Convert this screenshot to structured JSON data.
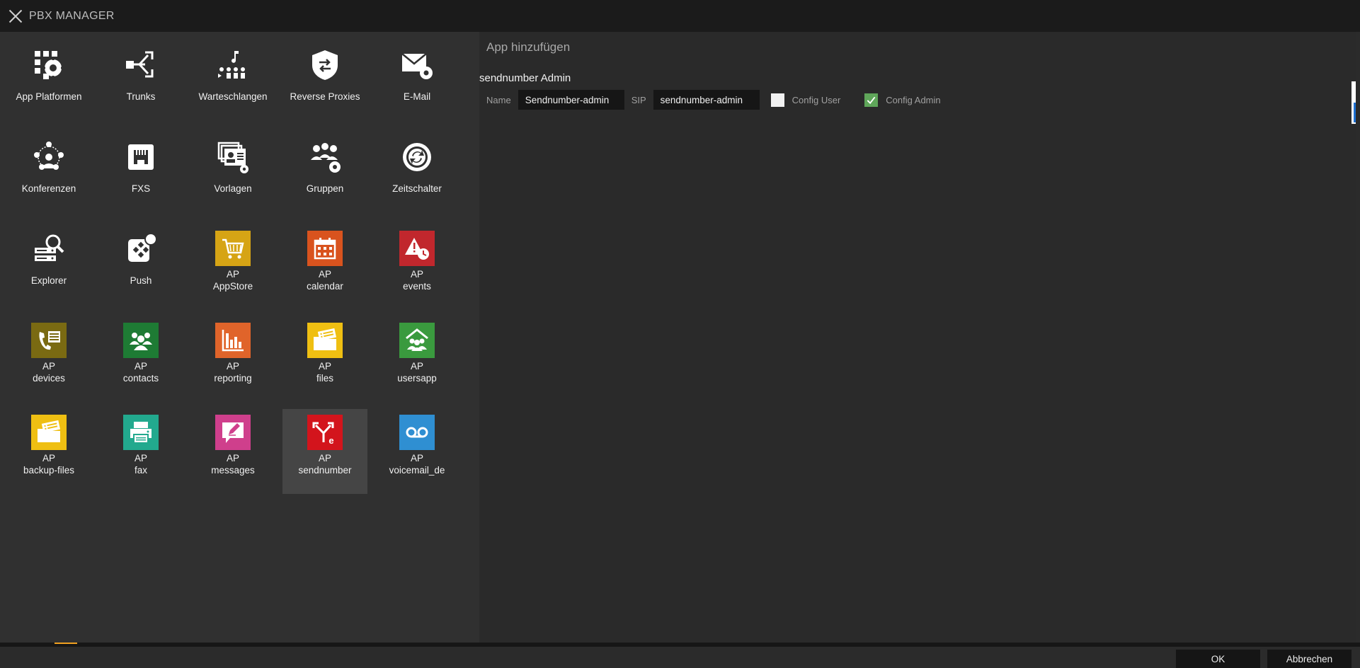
{
  "window": {
    "title": "PBX MANAGER"
  },
  "tiles": [
    {
      "label": "App Platformen",
      "icon": "app-platforms-icon"
    },
    {
      "label": "Trunks",
      "icon": "trunks-icon"
    },
    {
      "label": "Warteschlangen",
      "icon": "queues-icon"
    },
    {
      "label": "Reverse Proxies",
      "icon": "reverse-proxy-icon"
    },
    {
      "label": "E-Mail",
      "icon": "email-icon"
    },
    {
      "label": "Konferenzen",
      "icon": "conferences-icon"
    },
    {
      "label": "FXS",
      "icon": "fxs-icon"
    },
    {
      "label": "Vorlagen",
      "icon": "templates-icon"
    },
    {
      "label": "Gruppen",
      "icon": "groups-icon"
    },
    {
      "label": "Zeitschalter",
      "icon": "timer-icon"
    },
    {
      "label": "Explorer",
      "icon": "explorer-icon"
    },
    {
      "label": "Push",
      "icon": "push-icon"
    },
    {
      "label": "AP\nAppStore",
      "icon": "appstore-icon",
      "color": "#d6a415"
    },
    {
      "label": "AP\ncalendar",
      "icon": "calendar-icon",
      "color": "#d9531e"
    },
    {
      "label": "AP\nevents",
      "icon": "events-icon",
      "color": "#c1272d"
    },
    {
      "label": "AP\ndevices",
      "icon": "devices-icon",
      "color": "#7a6a12"
    },
    {
      "label": "AP\ncontacts",
      "icon": "contacts-icon",
      "color": "#1e7b34"
    },
    {
      "label": "AP\nreporting",
      "icon": "reporting-icon",
      "color": "#e0642a"
    },
    {
      "label": "AP\nfiles",
      "icon": "files-icon",
      "color": "#efbf12"
    },
    {
      "label": "AP\nusersapp",
      "icon": "usersapp-icon",
      "color": "#3a9a3e"
    },
    {
      "label": "AP\nbackup-files",
      "icon": "backup-files-icon",
      "color": "#efbf12"
    },
    {
      "label": "AP\nfax",
      "icon": "fax-icon",
      "color": "#22a98e"
    },
    {
      "label": "AP\nmessages",
      "icon": "messages-icon",
      "color": "#cf3f8c"
    },
    {
      "label": "AP\nsendnumber",
      "icon": "sendnumber-icon",
      "color": "#d3141c",
      "selected": true
    },
    {
      "label": "AP\nvoicemail_de",
      "icon": "voicemail-icon",
      "color": "#2f8fd2"
    }
  ],
  "detail": {
    "heading": "App hinzufügen",
    "section_title": "sendnumber Admin",
    "name_label": "Name",
    "name_value": "Sendnumber-admin",
    "sip_label": "SIP",
    "sip_value": "sendnumber-admin",
    "config_user_label": "Config User",
    "config_user_checked": false,
    "config_admin_label": "Config Admin",
    "config_admin_checked": true
  },
  "footer": {
    "ok_label": "OK",
    "cancel_label": "Abbrechen"
  }
}
